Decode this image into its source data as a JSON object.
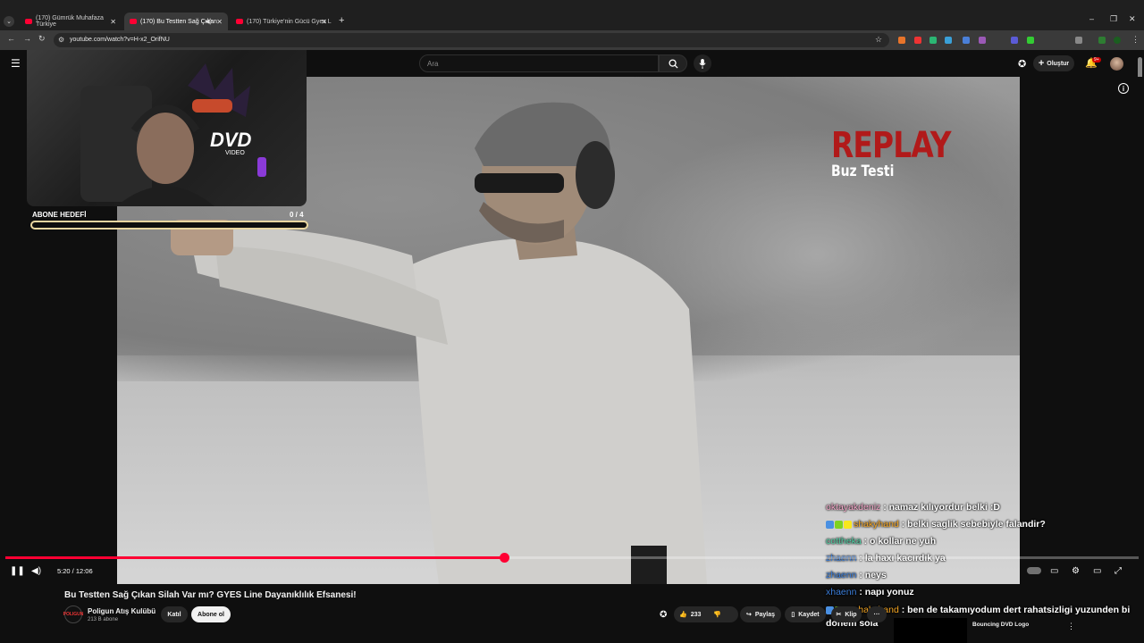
{
  "browser": {
    "tabs": [
      {
        "title": "(170) Gümrük Muhafaza Türkiye",
        "active": false
      },
      {
        "title": "(170) Bu Testten Sağ Çıkan",
        "active": true
      },
      {
        "title": "(170) Türkiye'nin Gücü Gyes L",
        "active": false
      }
    ],
    "url": "youtube.com/watch?v=H-x2_OrifNU"
  },
  "header": {
    "search_placeholder": "Ara",
    "create_label": "Oluştur",
    "notification_count": "9+"
  },
  "webcam": {
    "goal_label": "ABONE HEDEFİ",
    "goal_count": "0 / 4",
    "goal_progress": 0.0
  },
  "overlay": {
    "replay_title": "REPLAY",
    "replay_subtitle": "Buz Testi"
  },
  "chat": [
    {
      "user": "oktayakdeniz",
      "user_color": "#f4a6c8",
      "message": ": namaz kılıyordur belki :D",
      "badges": []
    },
    {
      "user": "shakyhand",
      "user_color": "#f5a623",
      "message": ": belki saglik sebebiyle falandir?",
      "badges": [
        "#4a90e2",
        "#7ed321",
        "#f8e71c"
      ]
    },
    {
      "user": "cottheka",
      "user_color": "#4fd1a5",
      "message": ": o kollar ne yuh",
      "badges": []
    },
    {
      "user": "zhaenn",
      "user_color": "#3b7dd8",
      "message": ": la haxı kacırdık ya",
      "badges": []
    },
    {
      "user": "zhaenn",
      "user_color": "#3b7dd8",
      "message": ": neys",
      "badges": []
    },
    {
      "user": "xhaenn",
      "user_color": "#3b7dd8",
      "message": ": napı yonuz",
      "badges": []
    },
    {
      "user": "shakyhand",
      "user_color": "#f5a623",
      "message": ": ben de takamıyodum dert rahatsizligi yuzunden bi donem sola",
      "badges": [
        "#4a90e2",
        "#7ed321",
        "#f8e71c"
      ]
    }
  ],
  "player": {
    "time": "5:20 / 12:06",
    "progress": 0.44
  },
  "video": {
    "title": "Bu Testten Sağ Çıkan Silah Var mı? GYES Line Dayanıklılık Efsanesi!",
    "channel": "Poligun Atış Kulübü",
    "channel_short": "POLIGUN",
    "subscribers": "213 B abone",
    "join_label": "Katıl",
    "subscribe_label": "Abone ol",
    "likes": "233",
    "share_label": "Paylaş",
    "save_label": "Kaydet",
    "clip_label": "Klip",
    "more_label": "···"
  },
  "recommendation": {
    "title": "Bouncing DVD Logo"
  },
  "webcam_logo": {
    "text": "DVD",
    "subtext": "VIDEO"
  }
}
